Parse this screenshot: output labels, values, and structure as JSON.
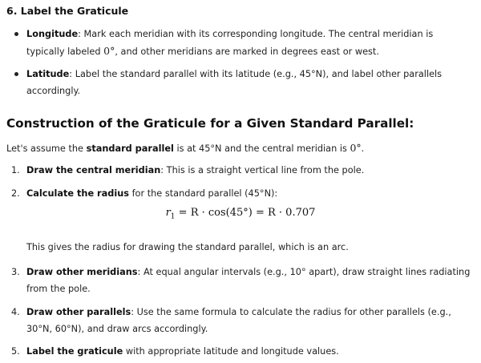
{
  "section": {
    "heading": "6. Label the Graticule"
  },
  "bullets": [
    {
      "term": "Longitude",
      "text1": ": Mark each meridian with its corresponding longitude. The central meridian is typically labeled ",
      "math": "0°",
      "text2": ", and other meridians are marked in degrees east or west."
    },
    {
      "term": "Latitude",
      "text1": ": Label the standard parallel with its latitude (e.g., 45°N), and label other parallels accordingly."
    }
  ],
  "construction": {
    "heading": "Construction of the Graticule for a Given Standard Parallel:",
    "intro_pre": "Let's assume the ",
    "intro_term": "standard parallel",
    "intro_mid": " is at 45°N and the central meridian is ",
    "intro_math": "0°",
    "intro_post": "."
  },
  "steps": [
    {
      "num": "1.",
      "term": "Draw the central meridian",
      "text": ": This is a straight vertical line from the pole."
    },
    {
      "num": "2.",
      "term": "Calculate the radius",
      "text": " for the standard parallel (45°N):"
    },
    {
      "num": "3.",
      "term": "Draw other meridians",
      "text": ": At equal angular intervals (e.g., 10° apart), draw straight lines radiating from the pole."
    },
    {
      "num": "4.",
      "term": "Draw other parallels",
      "text": ": Use the same formula to calculate the radius for other parallels (e.g., 30°N, 60°N), and draw arcs accordingly."
    },
    {
      "num": "5.",
      "term": "Label the graticule",
      "text": " with appropriate latitude and longitude values."
    }
  ],
  "equation": {
    "lhs": "r",
    "lhs_sub": "1",
    "rhs": " = R · cos(45°) = R · 0.707"
  },
  "note": "This gives the radius for drawing the standard parallel, which is an arc."
}
